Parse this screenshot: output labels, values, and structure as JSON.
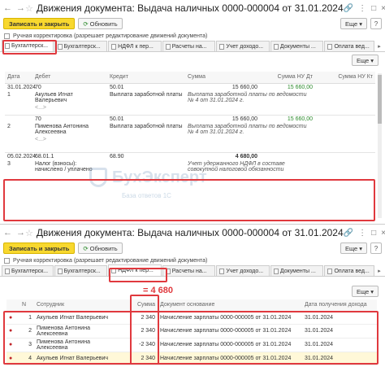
{
  "win1": {
    "title": "Движения документа: Выдача наличных 0000-000004 от 31.01.2024",
    "save_label": "Записать и закрыть",
    "refresh_label": "Обновить",
    "more_label": "Еще",
    "help_label": "?",
    "manual_label": "Ручная корректировка (разрешает редактирование движений документа)",
    "tabs": [
      "Бухгалтерск...",
      "Бухгалтерск...",
      "НДФЛ к пер...",
      "Расчеты на...",
      "Учет доходо...",
      "Документы ...",
      "Оплата вед..."
    ],
    "tbl_more_label": "Еще",
    "columns": [
      "Дата",
      "Дебет",
      "Кредит",
      "Сумма",
      "Сумма НУ Дт",
      "Сумма НУ Кт"
    ],
    "rows": [
      {
        "date": "31.01.2024",
        "n": "1",
        "debit": "70",
        "credit": "50.01",
        "sum": "15 660,00",
        "nu_dt": "15 660,00",
        "nu_kt": "",
        "debit_sub": "Акульев Игнат Валерьевич",
        "credit_sub": "Выплата заработной платы",
        "sum_note": "Выплата заработной платы по ведомости № 4 от 31.01.2024 г.",
        "debit_sub2": "<...>"
      },
      {
        "date": "",
        "n": "2",
        "debit": "70",
        "credit": "50.01",
        "sum": "15 660,00",
        "nu_dt": "15 660,00",
        "nu_kt": "",
        "debit_sub": "Пименова Антонина Алексеевна",
        "credit_sub": "Выплата заработной платы",
        "sum_note": "Выплата заработной платы по ведомости № 4 от 31.01.2024 г.",
        "debit_sub2": "<...>"
      },
      {
        "date": "05.02.2024",
        "n": "3",
        "debit": "68.01.1",
        "credit": "68.90",
        "sum": "4 680,00",
        "nu_dt": "",
        "nu_kt": "",
        "debit_sub": "Налог (взносы): начислено / уплачено",
        "credit_sub": "",
        "sum_note": "Учет удержанного НДФЛ в составе совокупной налоговой обязанности",
        "debit_sub2": ""
      }
    ]
  },
  "win2": {
    "title": "Движения документа: Выдача наличных 0000-000004 от 31.01.2024",
    "save_label": "Записать и закрыть",
    "refresh_label": "Обновить",
    "more_label": "Еще",
    "help_label": "?",
    "manual_label": "Ручная корректировка (разрешает редактирование движений документа)",
    "tabs": [
      "Бухгалтерск...",
      "Бухгалтерск...",
      "НДФЛ к пер...",
      "Расчеты на...",
      "Учет доходо...",
      "Документы ...",
      "Оплата вед..."
    ],
    "sum_annotation": "= 4 680",
    "tbl_more_label": "Еще",
    "columns": [
      "",
      "N",
      "Сотрудник",
      "Сумма",
      "Документ основание",
      "Дата получения дохода"
    ],
    "rows": [
      {
        "n": "1",
        "employee": "Акульев Игнат Валерьевич",
        "sum": "2 340",
        "doc": "Начисление зарплаты 0000-000005 от 31.01.2024",
        "date": "31.01.2024"
      },
      {
        "n": "2",
        "employee": "Пименова Антонина Алексеевна",
        "sum": "2 340",
        "doc": "Начисление зарплаты 0000-000005 от 31.01.2024",
        "date": "31.01.2024"
      },
      {
        "n": "3",
        "employee": "Пименова Антонина Алексеевна",
        "sum": "-2 340",
        "doc": "Начисление зарплаты 0000-000005 от 31.01.2024",
        "date": "31.01.2024"
      },
      {
        "n": "4",
        "employee": "Акульев Игнат Валерьевич",
        "sum": "2 340",
        "doc": "Начисление зарплаты 0000-000005 от 31.01.2024",
        "date": "31.01.2024"
      }
    ]
  },
  "watermark": {
    "brand": "БухЭксперт",
    "sub": "База ответов 1С"
  },
  "colors": {
    "accent": "#f8d82e",
    "highlight": "#e0393e",
    "sum_green": "#2c8a2c"
  }
}
